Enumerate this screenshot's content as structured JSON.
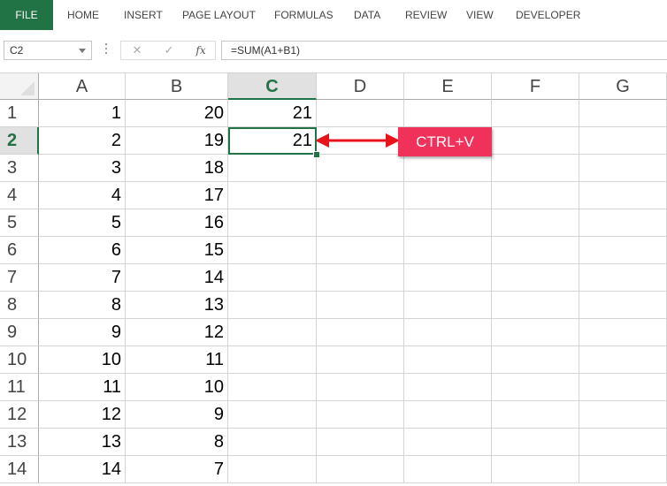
{
  "ribbon": {
    "tabs": [
      {
        "label": "FILE"
      },
      {
        "label": "HOME"
      },
      {
        "label": "INSERT"
      },
      {
        "label": "PAGE LAYOUT"
      },
      {
        "label": "FORMULAS"
      },
      {
        "label": "DATA"
      },
      {
        "label": "REVIEW"
      },
      {
        "label": "VIEW"
      },
      {
        "label": "DEVELOPER"
      }
    ]
  },
  "formula_bar": {
    "name_box": "C2",
    "cancel_icon": "cancel-x-icon",
    "enter_icon": "enter-check-icon",
    "fx_label": "fx",
    "formula": "=SUM(A1+B1)"
  },
  "columns": [
    "A",
    "B",
    "C",
    "D",
    "E",
    "F",
    "G"
  ],
  "selected_column": "C",
  "selected_row": "2",
  "rows": [
    {
      "num": "1",
      "a": "1",
      "b": "20",
      "c": "21"
    },
    {
      "num": "2",
      "a": "2",
      "b": "19",
      "c": "21"
    },
    {
      "num": "3",
      "a": "3",
      "b": "18",
      "c": ""
    },
    {
      "num": "4",
      "a": "4",
      "b": "17",
      "c": ""
    },
    {
      "num": "5",
      "a": "5",
      "b": "16",
      "c": ""
    },
    {
      "num": "6",
      "a": "6",
      "b": "15",
      "c": ""
    },
    {
      "num": "7",
      "a": "7",
      "b": "14",
      "c": ""
    },
    {
      "num": "8",
      "a": "8",
      "b": "13",
      "c": ""
    },
    {
      "num": "9",
      "a": "9",
      "b": "12",
      "c": ""
    },
    {
      "num": "10",
      "a": "10",
      "b": "11",
      "c": ""
    },
    {
      "num": "11",
      "a": "11",
      "b": "10",
      "c": ""
    },
    {
      "num": "12",
      "a": "12",
      "b": "9",
      "c": ""
    },
    {
      "num": "13",
      "a": "13",
      "b": "8",
      "c": ""
    },
    {
      "num": "14",
      "a": "14",
      "b": "7",
      "c": ""
    }
  ],
  "annotation": {
    "label": "CTRL+V",
    "color": "#f0325a",
    "arrow_color": "#e8141c"
  },
  "colors": {
    "accent": "#217346"
  }
}
